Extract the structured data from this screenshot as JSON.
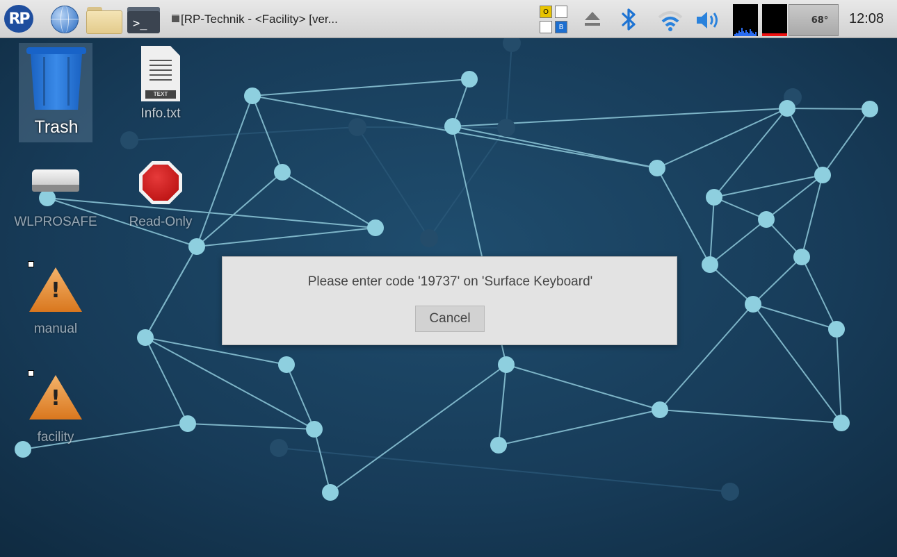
{
  "taskbar": {
    "window_title": "[RP-Technik - <Facility> [ver...",
    "keyboard_indicator": {
      "top": "O",
      "bottom": "B"
    },
    "temperature": "68°",
    "clock": "12:08",
    "icons": [
      "rp-logo",
      "globe-icon",
      "folder-icon",
      "terminal-icon",
      "eject-icon",
      "bluetooth-icon",
      "wifi-icon",
      "volume-icon"
    ],
    "terminal_glyph": ">_",
    "logo_text": "RP"
  },
  "desktop": {
    "icons": [
      {
        "label": "Trash",
        "icon": "trash-icon"
      },
      {
        "label": "Info.txt",
        "icon": "text-file-icon",
        "badge": "TEXT"
      },
      {
        "label": "WLPROSAFE",
        "icon": "drive-icon"
      },
      {
        "label": "Read-Only",
        "icon": "stop-sign-icon"
      },
      {
        "label": "manual",
        "icon": "warning-icon"
      },
      {
        "label": "facility",
        "icon": "warning-icon"
      }
    ]
  },
  "dialog": {
    "message": "Please enter code '19737' on 'Surface Keyboard'",
    "cancel_label": "Cancel"
  },
  "colors": {
    "background": "#1a3a55",
    "network_node": "#8ecfdf",
    "taskbar": "#dcdcdc",
    "accent_blue": "#1d73d3"
  }
}
